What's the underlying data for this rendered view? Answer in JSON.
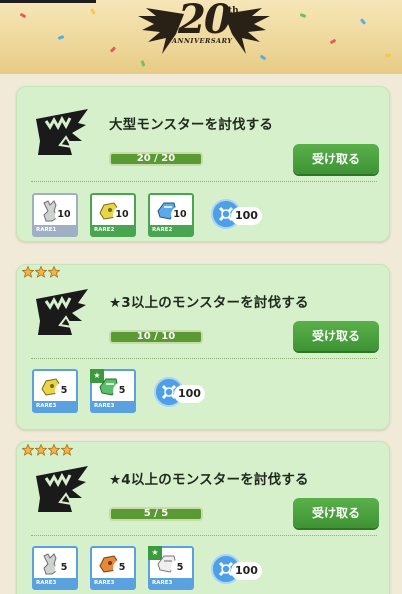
{
  "banner": {
    "logo_number": "20",
    "logo_suffix": "th",
    "logo_text": "ANNIVERSARY"
  },
  "missions": [
    {
      "stars": 0,
      "title": "大型モンスターを討伐する",
      "progress_text": "20 / 20",
      "progress": 1.0,
      "button_label": "受け取る",
      "rewards": [
        {
          "count": "10",
          "rarity": "RARE1",
          "frame": "gray",
          "icon": "monster-material-icon"
        },
        {
          "count": "10",
          "rarity": "RARE2",
          "frame": "green",
          "icon": "yellow-armor-icon"
        },
        {
          "count": "10",
          "rarity": "RARE2",
          "frame": "green",
          "icon": "blue-armor-icon"
        }
      ],
      "token_amount": "100"
    },
    {
      "stars": 3,
      "title": "★3以上のモンスターを討伐する",
      "progress_text": "10 / 10",
      "progress": 1.0,
      "button_label": "受け取る",
      "rewards": [
        {
          "count": "5",
          "rarity": "RARE3",
          "frame": "blue",
          "icon": "yellow-armor-icon"
        },
        {
          "count": "5",
          "rarity": "RARE3",
          "frame": "blue",
          "icon": "green-armor-icon",
          "flag": "★"
        }
      ],
      "token_amount": "100"
    },
    {
      "stars": 4,
      "title": "★4以上のモンスターを討伐する",
      "progress_text": "5 / 5",
      "progress": 1.0,
      "button_label": "受け取る",
      "rewards": [
        {
          "count": "5",
          "rarity": "RARE3",
          "frame": "blue",
          "icon": "monster-material-icon"
        },
        {
          "count": "5",
          "rarity": "RARE3",
          "frame": "blue",
          "icon": "orange-armor-icon"
        },
        {
          "count": "5",
          "rarity": "RARE3",
          "frame": "blue",
          "icon": "white-armor-icon",
          "flag": "★"
        }
      ],
      "token_amount": "100"
    }
  ],
  "colors": {
    "card_bg": "#d7f0cc",
    "button": "#4ca33f",
    "progress": "#5a9a33",
    "star": "#f0b64a",
    "token": "#4d9fe8"
  }
}
